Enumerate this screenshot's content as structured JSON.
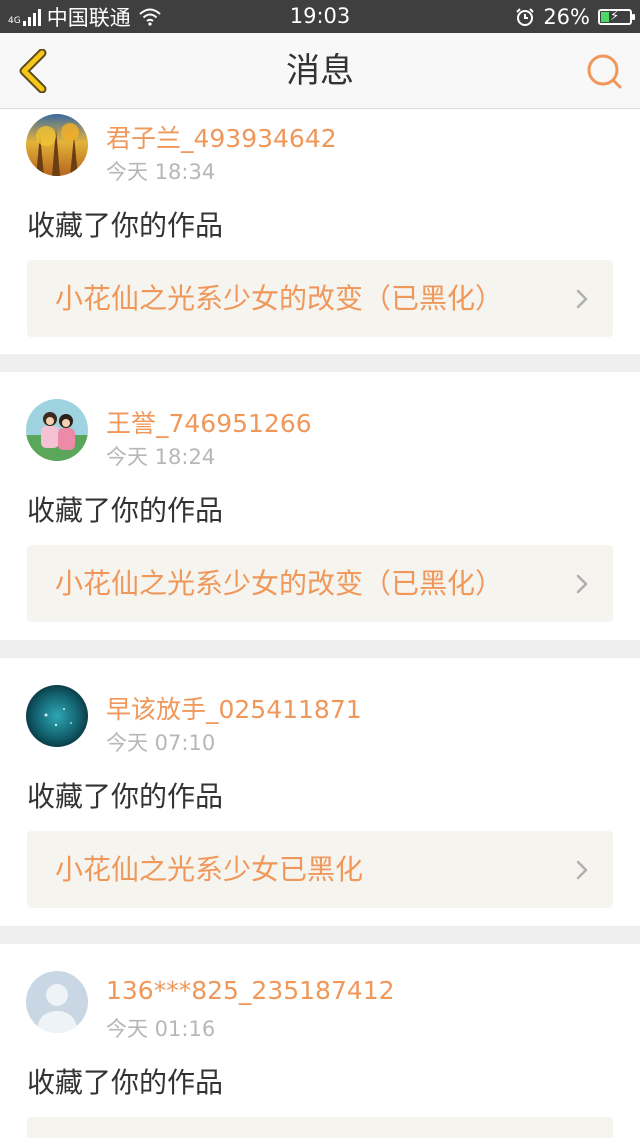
{
  "status_bar": {
    "network_label": "4G",
    "carrier": "中国联通",
    "time": "19:03",
    "battery": "26%",
    "icons": [
      "signal-icon",
      "wifi-icon",
      "alarm-icon",
      "battery-icon"
    ]
  },
  "nav": {
    "title": "消息",
    "back_icon": "back-chevron-icon",
    "search_icon": "search-icon"
  },
  "colors": {
    "accent": "#f0975a",
    "back_icon": "#f5c518",
    "text_primary": "#333333",
    "text_secondary": "#b7b7b7",
    "link_bg": "#f5f4ef"
  },
  "messages": [
    {
      "username": "君子兰_493934642",
      "time": "今天 18:34",
      "action": "收藏了你的作品",
      "work_title": "小花仙之光系少女的改变（已黑化）"
    },
    {
      "username": "王誉_746951266",
      "time": "今天 18:24",
      "action": "收藏了你的作品",
      "work_title": "小花仙之光系少女的改变（已黑化）"
    },
    {
      "username": "早该放手_025411871",
      "time": "今天 07:10",
      "action": "收藏了你的作品",
      "work_title": "小花仙之光系少女已黑化"
    },
    {
      "username": "136***825_235187412",
      "time": "今天 01:16",
      "action": "收藏了你的作品",
      "work_title": ""
    }
  ]
}
